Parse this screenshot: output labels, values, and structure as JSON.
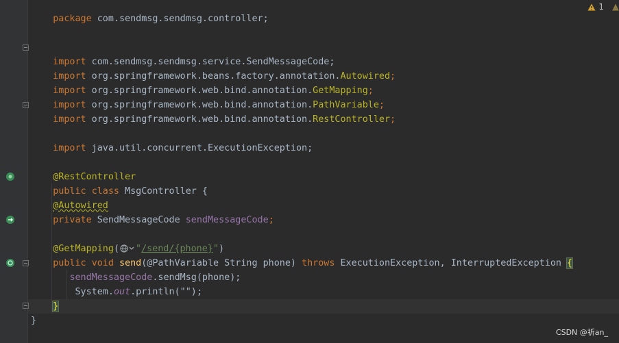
{
  "editor": {
    "lines": {
      "package": {
        "kw": "package",
        "rest": " com.sendmsg.sendmsg.controller;"
      },
      "i1": {
        "kw": "import",
        "rest": " com.sendmsg.sendmsg.service.SendMessageCode;"
      },
      "i2": {
        "kw": "import",
        "pre": " org.springframework.beans.factory.annotation.",
        "cls": "Autowired",
        "post": ";"
      },
      "i3": {
        "kw": "import",
        "pre": " org.springframework.web.bind.annotation.",
        "cls": "GetMapping",
        "post": ";"
      },
      "i4": {
        "kw": "import",
        "pre": " org.springframework.web.bind.annotation.",
        "cls": "PathVariable",
        "post": ";"
      },
      "i5": {
        "kw": "import",
        "pre": " org.springframework.web.bind.annotation.",
        "cls": "RestController",
        "post": ";"
      },
      "i6": {
        "kw": "import",
        "rest": " java.util.concurrent.ExecutionException;"
      },
      "ann1": "@RestController",
      "classdecl": {
        "kw1": "public",
        "kw2": "class",
        "name": " MsgController {"
      },
      "ann2": "@Autowired",
      "field": {
        "kw": "private",
        "type": " SendMessageCode ",
        "name": "sendMessageCode",
        "end": ";"
      },
      "mapping": {
        "ann": "@GetMapping",
        "open": "(",
        "q1": "\"",
        "path": "/send/{phone}",
        "q2": "\"",
        "close": ")"
      },
      "method": {
        "kw1": "public",
        "kw2": "void",
        "name": "send",
        "args": "(@PathVariable String phone) ",
        "throws": "throws",
        "ex": " ExecutionException, InterruptedException ",
        "brace": "{"
      },
      "call1": {
        "field": "sendMessageCode",
        "rest": ".sendMsg(phone);"
      },
      "call2": {
        "pre": "System.",
        "out": "out",
        "rest": ".println(\"\");"
      },
      "close1": "}",
      "close2": "}"
    }
  },
  "status": {
    "warnings": "1"
  },
  "watermark": "CSDN @祈an_",
  "colors": {
    "background": "#2b2b2b",
    "keyword": "#cc7832",
    "annotation": "#bbb529",
    "string": "#6a8759",
    "field": "#9876aa"
  }
}
